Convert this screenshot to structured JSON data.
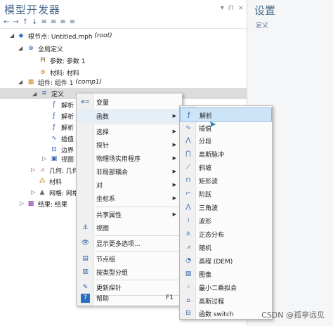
{
  "builder": {
    "title": "模型开发器",
    "toolbar_icons": [
      "←",
      "→",
      "↑",
      "↓",
      "≡",
      "≡",
      "≡",
      "≡"
    ],
    "window_icons": [
      "▾",
      "⊓",
      "×"
    ],
    "tree": {
      "root": {
        "label": "根节点: Untitled.mph",
        "tag": "(root)"
      },
      "global_def": "全局定义",
      "params": "参数: 参数 1",
      "materials": "材料: 材料",
      "component": {
        "label": "组件: 组件 1",
        "tag": "(comp1)"
      },
      "definitions": "定义",
      "analytic1": "解析",
      "analytic2": "解析",
      "analytic3": "解析",
      "interp": "插值",
      "boundary": "边界",
      "view": "视图",
      "geometry": "几何: 几何",
      "mat": "材料",
      "mesh": "网格: 网格",
      "results": "结果: 结果"
    }
  },
  "settings": {
    "title": "设置",
    "subtitle": "定义"
  },
  "context_menu": {
    "items": [
      {
        "label": "变量",
        "icon": "a=",
        "submenu": false
      },
      {
        "label": "函数",
        "icon": "",
        "submenu": true,
        "highlight": true
      },
      {
        "label": "选择",
        "icon": "",
        "submenu": true
      },
      {
        "label": "探针",
        "icon": "",
        "submenu": true
      },
      {
        "label": "物理场实用程序",
        "icon": "",
        "submenu": true
      },
      {
        "label": "非局部耦合",
        "icon": "",
        "submenu": true
      },
      {
        "label": "对",
        "icon": "",
        "submenu": true
      },
      {
        "label": "坐标系",
        "icon": "",
        "submenu": true
      },
      {
        "label": "共享属性",
        "icon": "",
        "submenu": true
      },
      {
        "label": "视图",
        "icon": "⚓",
        "submenu": false
      },
      {
        "label": "显示更多选项...",
        "icon": "👁",
        "submenu": false
      },
      {
        "label": "节点组",
        "icon": "▤",
        "submenu": false
      },
      {
        "label": "按类型分组",
        "icon": "▥",
        "submenu": false
      },
      {
        "label": "更新探针",
        "icon": "✎",
        "submenu": false
      },
      {
        "label": "帮助",
        "icon": "?",
        "submenu": false,
        "shortcut": "F1"
      }
    ]
  },
  "function_menu": {
    "items": [
      {
        "label": "解析",
        "icon": "ƒ"
      },
      {
        "label": "插值",
        "icon": "∿"
      },
      {
        "label": "分段",
        "icon": "⋀"
      },
      {
        "label": "高斯脉冲",
        "icon": "⋂"
      },
      {
        "label": "斜坡",
        "icon": "⟋"
      },
      {
        "label": "矩形波",
        "icon": "⊓"
      },
      {
        "label": "阶跃",
        "icon": "⌐"
      },
      {
        "label": "三角波",
        "icon": "⋀"
      },
      {
        "label": "波形",
        "icon": "≀"
      },
      {
        "label": "正态分布",
        "icon": "⫛"
      },
      {
        "label": "随机",
        "icon": "⩘"
      },
      {
        "label": "高程 (DEM)",
        "icon": "◔"
      },
      {
        "label": "图像",
        "icon": "▨"
      },
      {
        "label": "最小二乘拟合",
        "icon": "⁘"
      },
      {
        "label": "高斯过程",
        "icon": "⌂"
      },
      {
        "label": "函数 switch",
        "icon": "⊟"
      }
    ]
  },
  "watermark": "CSDN @孤亭远见"
}
